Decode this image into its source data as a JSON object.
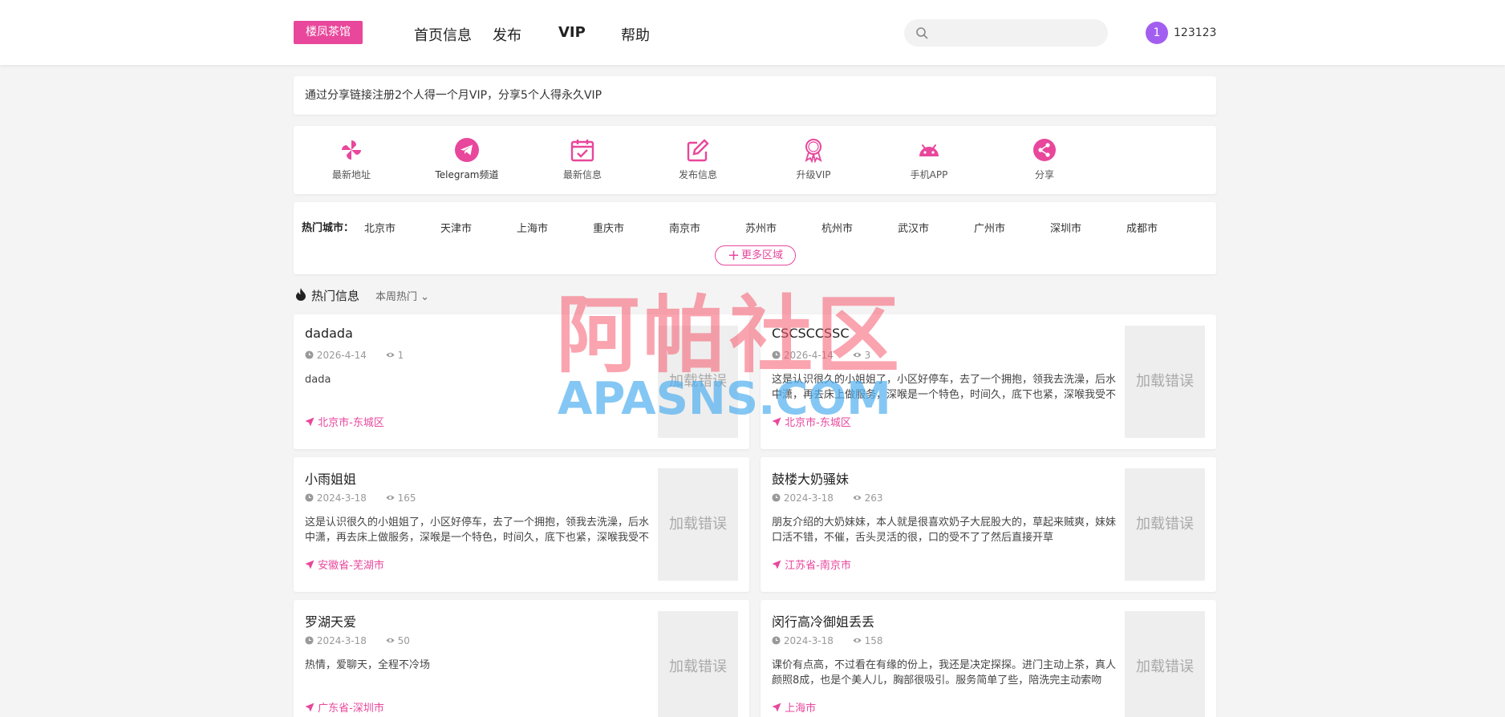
{
  "header": {
    "logo": "楼凤茶馆",
    "nav": [
      "首页信息",
      "发布",
      "VIP",
      "帮助"
    ],
    "search_placeholder": "",
    "user_badge": "1",
    "username": "123123"
  },
  "notice": "通过分享链接注册2个人得一个月VIP，分享5个人得永久VIP",
  "quick_links": [
    {
      "label": "最新地址",
      "icon": "pinwheel-icon"
    },
    {
      "label": "Telegram频道",
      "icon": "telegram-icon"
    },
    {
      "label": "最新信息",
      "icon": "calendar-icon"
    },
    {
      "label": "发布信息",
      "icon": "edit-icon"
    },
    {
      "label": "升级VIP",
      "icon": "vip-badge-icon"
    },
    {
      "label": "手机APP",
      "icon": "android-icon"
    },
    {
      "label": "分享",
      "icon": "share-icon"
    }
  ],
  "cities": {
    "title": "热门城市：",
    "list": [
      "北京市",
      "天津市",
      "上海市",
      "重庆市",
      "南京市",
      "苏州市",
      "杭州市",
      "武汉市",
      "广州市",
      "深圳市",
      "成都市"
    ],
    "more": "更多区域"
  },
  "section": {
    "title": "热门信息",
    "filter": "本周热门"
  },
  "image_error": "加载错误",
  "posts": [
    {
      "title": "dadada",
      "date": "2026-4-14",
      "views": "1",
      "desc": "dada",
      "location": "北京市-东城区"
    },
    {
      "title": "CSCSCCSSC",
      "date": "2026-4-14",
      "views": "3",
      "desc": "这是认识很久的小姐姐了，小区好停车，去了一个拥抱，领我去洗澡，后水中潇，再去床上做服务，深喉是一个特色，时间久，底下也紧，深喉我受不了",
      "location": "北京市-东城区"
    },
    {
      "title": "小雨姐姐",
      "date": "2024-3-18",
      "views": "165",
      "desc": "这是认识很久的小姐姐了，小区好停车，去了一个拥抱，领我去洗澡，后水中潇，再去床上做服务，深喉是一个特色，时间久，底下也紧，深喉我受不了",
      "location": "安徽省-芜湖市"
    },
    {
      "title": "鼓楼大奶骚妹",
      "date": "2024-3-18",
      "views": "263",
      "desc": "朋友介绍的大奶妹妹，本人就是很喜欢奶子大屁股大的，草起来贼爽，妹妹口活不错，不催，舌头灵活的很，口的受不了了然后直接开草",
      "location": "江苏省-南京市"
    },
    {
      "title": "罗湖天爱",
      "date": "2024-3-18",
      "views": "50",
      "desc": "热情，爱聊天，全程不冷场",
      "location": "广东省-深圳市"
    },
    {
      "title": "闵行高冷御姐丢丢",
      "date": "2024-3-18",
      "views": "158",
      "desc": "课价有点高，不过看在有缘的份上，我还是决定探探。进门主动上茶，真人颜照8成，也是个美人儿，胸部很吸引。服务简单了些，陪洗完主动索吻",
      "location": "上海市"
    }
  ],
  "watermark": {
    "cn": "阿帕社区",
    "en": "APASNS.COM"
  },
  "colors": {
    "accent": "#e8479c",
    "avatar": "#a25ef0"
  }
}
